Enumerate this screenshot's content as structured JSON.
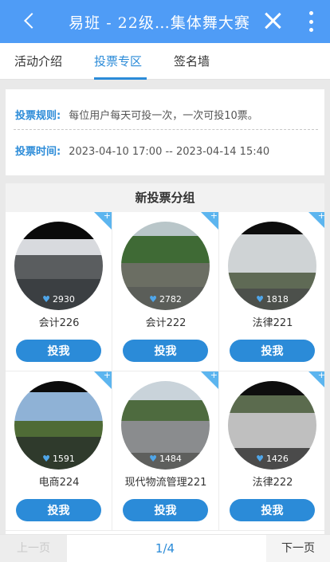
{
  "header": {
    "title": "易班 - 22级…集体舞大赛",
    "back_icon": "back-arrow-icon",
    "close_icon": "close-icon",
    "more_icon": "more-vertical-icon"
  },
  "tabs": [
    {
      "label": "活动介绍",
      "active": false
    },
    {
      "label": "投票专区",
      "active": true
    },
    {
      "label": "签名墙",
      "active": false
    }
  ],
  "rules": {
    "rule_label": "投票规则:",
    "rule_text": "每位用户每天可投一次，一次可投10票。",
    "time_label": "投票时间:",
    "time_text": "2023-04-10 17:00 -- 2023-04-14 15:40"
  },
  "group": {
    "title": "新投票分组",
    "vote_button_label": "投我",
    "accent_color": "#2b8bd8",
    "entries": [
      {
        "name": "会计226",
        "votes": "2930",
        "vote_label": "投我"
      },
      {
        "name": "会计222",
        "votes": "2782",
        "vote_label": "投我"
      },
      {
        "name": "法律221",
        "votes": "1818",
        "vote_label": "投我"
      },
      {
        "name": "电商224",
        "votes": "1591",
        "vote_label": "投我"
      },
      {
        "name": "现代物流管理221",
        "votes": "1484",
        "vote_label": "投我"
      },
      {
        "name": "法律222",
        "votes": "1426",
        "vote_label": "投我"
      }
    ]
  },
  "pager": {
    "prev_label": "上一页",
    "page_indicator": "1/4",
    "next_label": "下一页"
  }
}
